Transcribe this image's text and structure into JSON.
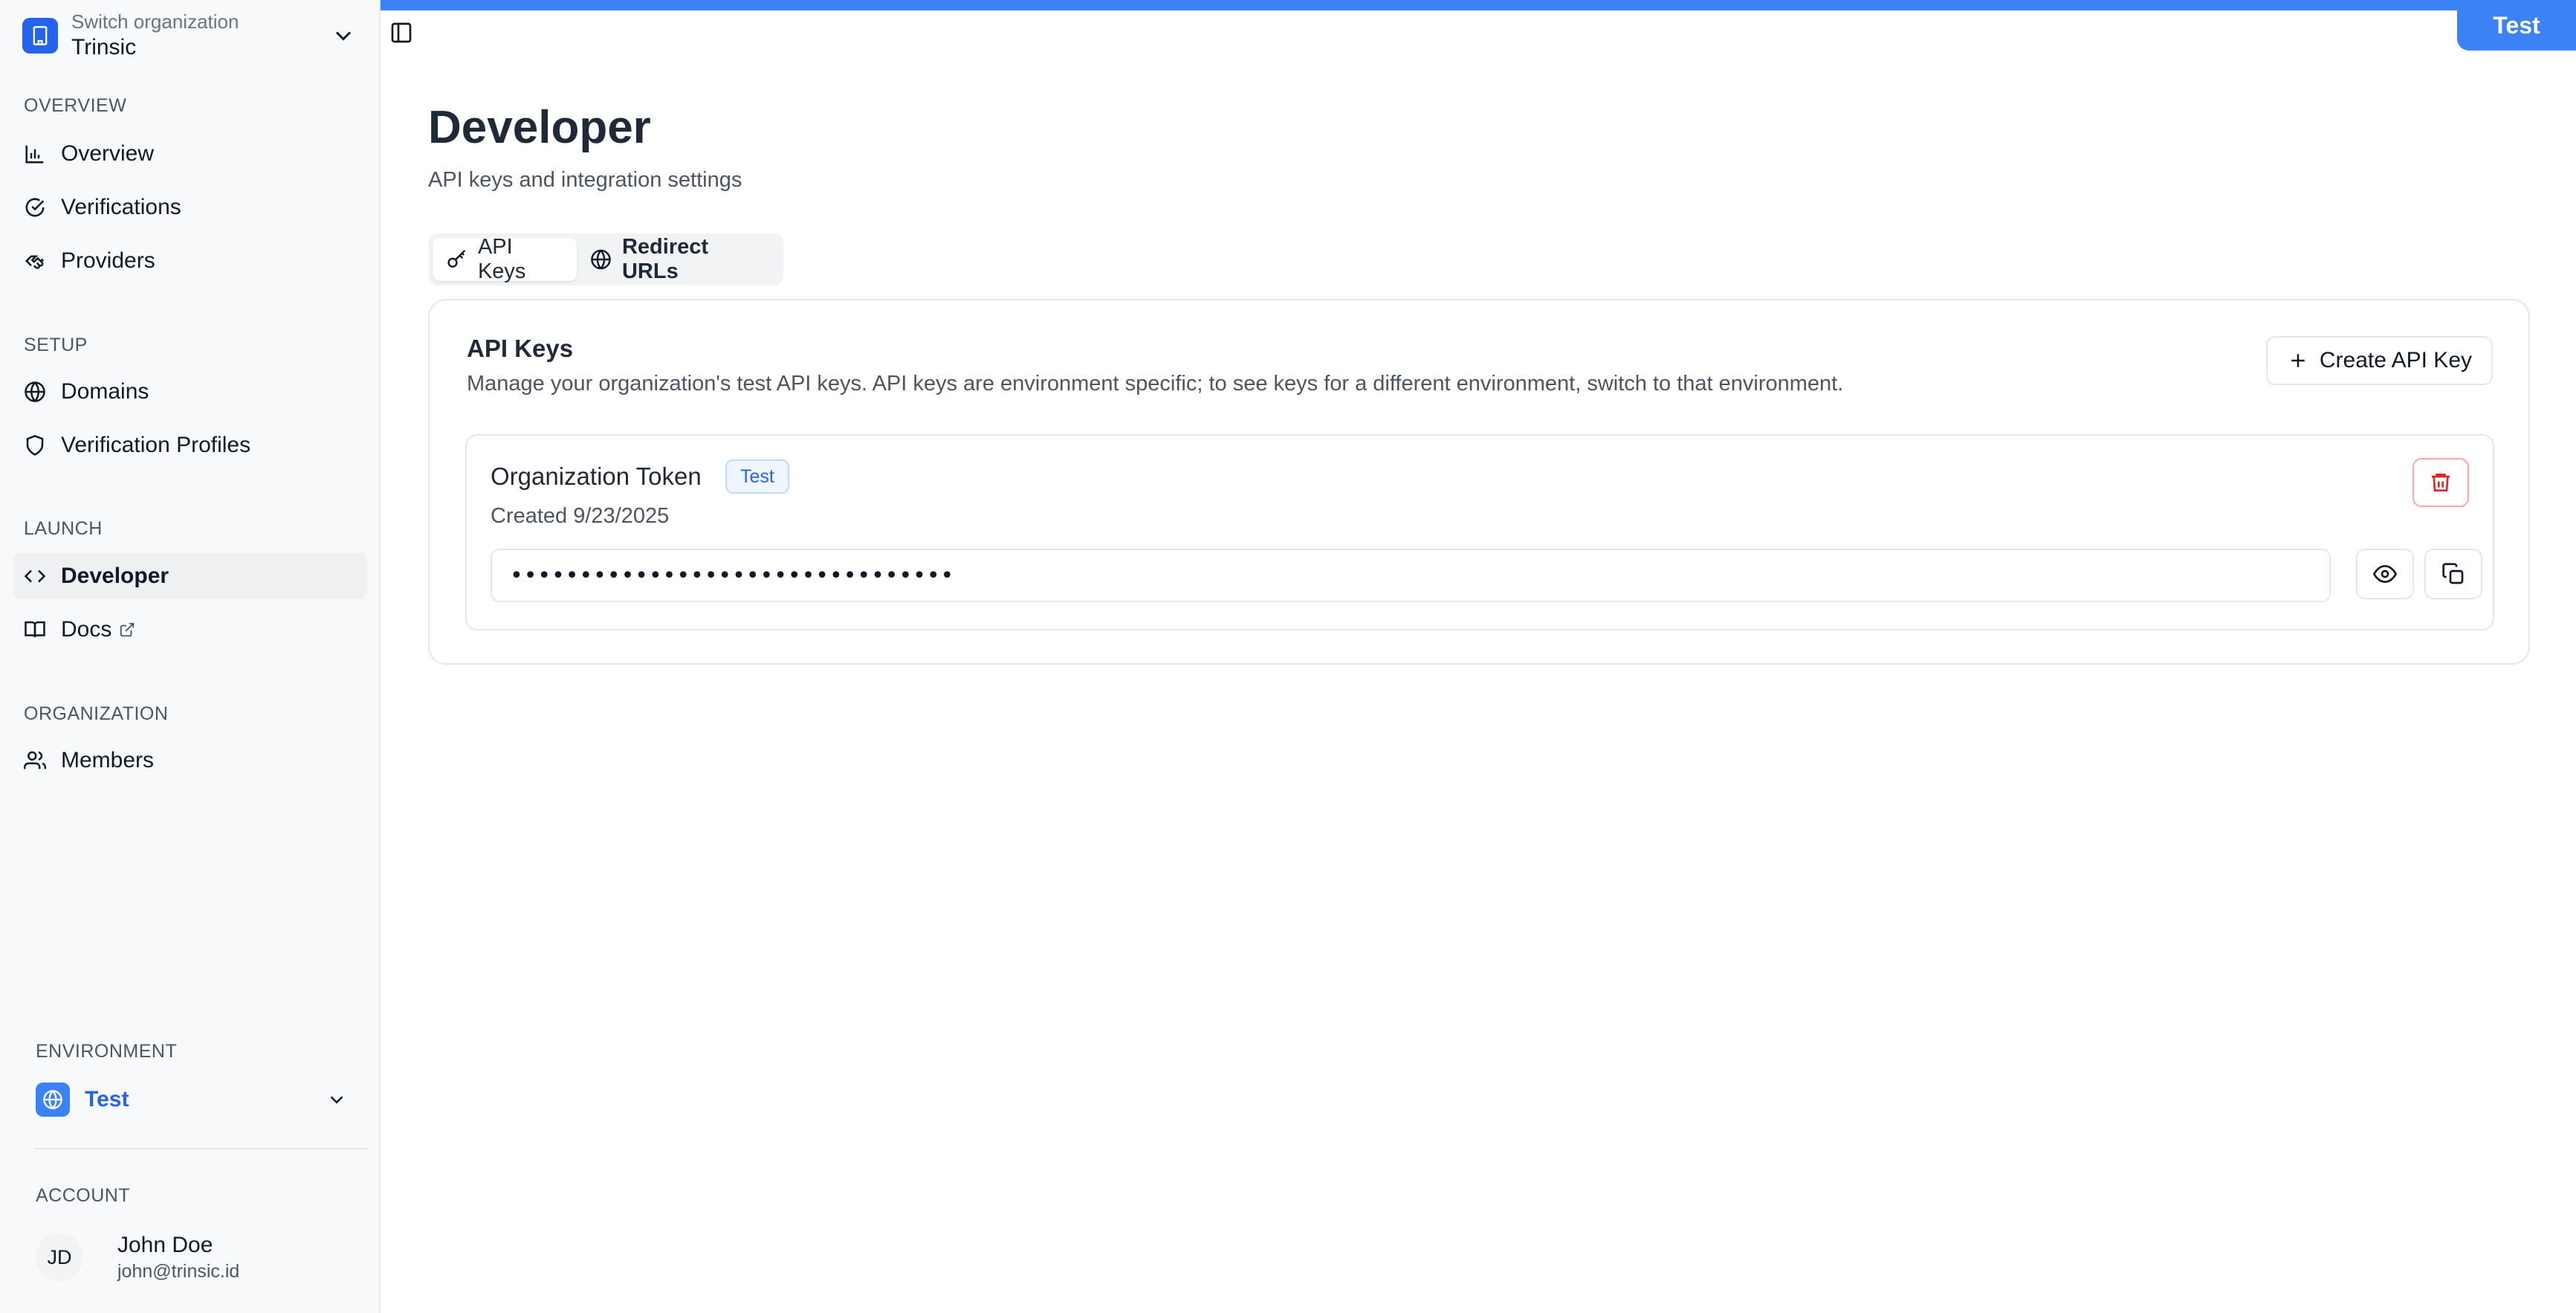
{
  "sidebar": {
    "org_switch": {
      "label": "Switch organization",
      "name": "Trinsic"
    },
    "sections": {
      "overview": "OVERVIEW",
      "setup": "SETUP",
      "launch": "LAUNCH",
      "organization": "ORGANIZATION"
    },
    "items": {
      "overview": "Overview",
      "verifications": "Verifications",
      "providers": "Providers",
      "domains": "Domains",
      "verification_profiles": "Verification Profiles",
      "developer": "Developer",
      "docs": "Docs",
      "members": "Members"
    },
    "environment": {
      "label": "ENVIRONMENT",
      "value": "Test"
    },
    "account": {
      "label": "ACCOUNT",
      "initials": "JD",
      "name": "John Doe",
      "email": "john@trinsic.id"
    }
  },
  "header": {
    "env_badge": "Test"
  },
  "main": {
    "title": "Developer",
    "subtitle": "API keys and integration settings",
    "tabs": [
      {
        "label": "API Keys",
        "active": true
      },
      {
        "label": "Redirect URLs",
        "active": false
      }
    ],
    "api_keys": {
      "title": "API Keys",
      "description": "Manage your organization's test API keys. API keys are environment specific; to see keys for a different environment, switch to that environment.",
      "create_label": "Create API Key",
      "tokens": [
        {
          "name": "Organization Token",
          "badge": "Test",
          "created": "Created 9/23/2025",
          "masked_value": "••••••••••••••••••••••••••••••••"
        }
      ]
    }
  },
  "colors": {
    "accent": "#3b82f6",
    "accent_dark": "#2563eb",
    "danger": "#dc2626"
  }
}
